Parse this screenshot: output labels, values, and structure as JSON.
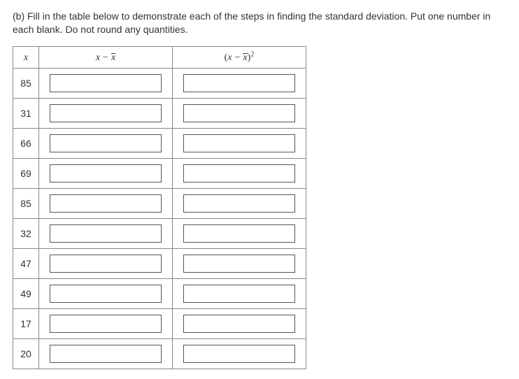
{
  "prompt": "(b) Fill in the table below to demonstrate each of the steps in finding the standard deviation. Put one number in each blank. Do not round any quantities.",
  "columns": {
    "x": "x",
    "dev": "x − x̄",
    "sq": "(x − x̄)²"
  },
  "rows": [
    {
      "x": "85",
      "dev": "",
      "sq": ""
    },
    {
      "x": "31",
      "dev": "",
      "sq": ""
    },
    {
      "x": "66",
      "dev": "",
      "sq": ""
    },
    {
      "x": "69",
      "dev": "",
      "sq": ""
    },
    {
      "x": "85",
      "dev": "",
      "sq": ""
    },
    {
      "x": "32",
      "dev": "",
      "sq": ""
    },
    {
      "x": "47",
      "dev": "",
      "sq": ""
    },
    {
      "x": "49",
      "dev": "",
      "sq": ""
    },
    {
      "x": "17",
      "dev": "",
      "sq": ""
    },
    {
      "x": "20",
      "dev": "",
      "sq": ""
    }
  ]
}
